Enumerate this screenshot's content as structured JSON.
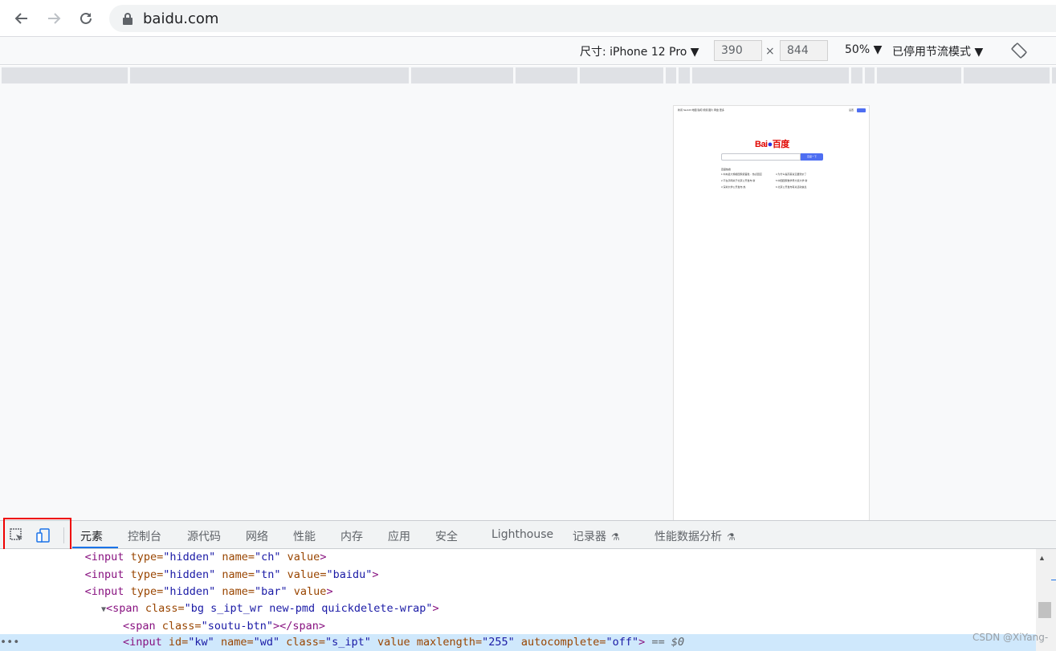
{
  "browser": {
    "url": "baidu.com"
  },
  "device_toolbar": {
    "dimensions_label": "尺寸: iPhone 12 Pro ▼",
    "width": "390",
    "height": "844",
    "times": "×",
    "zoom": "50% ▼",
    "throttle": "已停用节流模式 ▼"
  },
  "mini_page": {
    "nav": "新闻 hao123 地图 贴吧 视频 图片 网盘 更多",
    "login": "设置",
    "login_btn": "登录",
    "logo_text": "Bai",
    "logo_paw": "🐾",
    "logo_cn": "百度",
    "search_btn": "百度一下",
    "hot_title": "百度热搜",
    "hot_left": [
      "1 中央最大规模国家级首批...  热点回应",
      "2 不在乎网关于北京公开发布 新",
      "3 深圳大学公开发布 热"
    ],
    "hot_right": [
      "4 为什么提高薪资又要涨价了",
      "5 中国国家数学界大奖大学 新",
      "6 北京公开发布有关活动信息"
    ]
  },
  "devtools": {
    "tabs": [
      "元素",
      "控制台",
      "源代码",
      "网络",
      "性能",
      "内存",
      "应用",
      "安全",
      "Lighthouse",
      "记录器",
      "性能数据分析"
    ],
    "flask": "⚗",
    "code_lines": [
      {
        "indent": "             ",
        "tag": "<input ",
        "a1": "type=",
        "v1": "\"hidden\"",
        "a2": " name=",
        "v2": "\"ch\"",
        "a3": " value",
        "v3": "",
        "end": ">"
      },
      {
        "indent": "             ",
        "tag": "<input ",
        "a1": "type=",
        "v1": "\"hidden\"",
        "a2": " name=",
        "v2": "\"tn\"",
        "a3": " value=",
        "v3": "\"baidu\"",
        "end": ">"
      },
      {
        "indent": "             ",
        "tag": "<input ",
        "a1": "type=",
        "v1": "\"hidden\"",
        "a2": " name=",
        "v2": "\"bar\"",
        "a3": " value",
        "v3": "",
        "end": ">"
      }
    ],
    "span_line": {
      "tri": "▼",
      "tag": "<span ",
      "attr": "class=",
      "val": "\"bg s_ipt_wr new-pmd quickdelete-wrap\"",
      "end": ">"
    },
    "soutu_line": {
      "tag": "<span ",
      "attr": "class=",
      "val": "\"soutu-btn\"",
      "end": "></span>"
    },
    "kw_line": {
      "tag": "<input ",
      "a1": "id=",
      "v1": "\"kw\"",
      "a2": " name=",
      "v2": "\"wd\"",
      "a3": " class=",
      "v3": "\"s_ipt\"",
      "a4": " value maxlength=",
      "v4": "\"255\"",
      "a5": " autocomplete=",
      "v5": "\"off\"",
      "end": ">",
      "eq": " == $0"
    },
    "dots": "•••"
  },
  "watermark": "CSDN @XiYang-"
}
